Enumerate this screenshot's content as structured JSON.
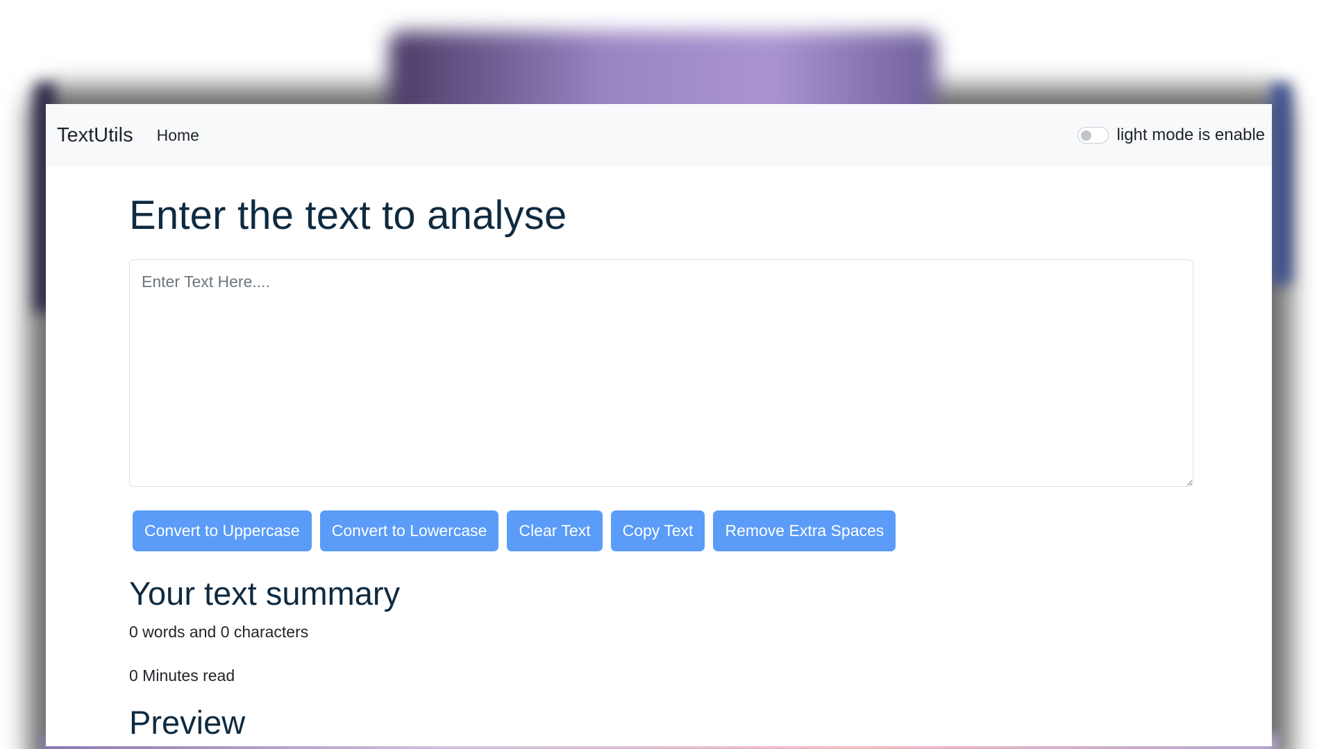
{
  "navbar": {
    "brand": "TextUtils",
    "links": [
      {
        "label": "Home"
      }
    ],
    "mode_toggle": {
      "label": "light mode is enable",
      "checked": false
    }
  },
  "main": {
    "title": "Enter the text to analyse",
    "textarea": {
      "value": "",
      "placeholder": "Enter Text Here...."
    },
    "buttons": [
      {
        "label": "Convert to Uppercase"
      },
      {
        "label": "Convert to Lowercase"
      },
      {
        "label": "Clear Text"
      },
      {
        "label": "Copy Text"
      },
      {
        "label": "Remove Extra Spaces"
      }
    ],
    "summary": {
      "title": "Your text summary",
      "counts": "0 words and 0 characters",
      "read_time": "0 Minutes read"
    },
    "preview": {
      "title": "Preview"
    }
  },
  "colors": {
    "button_bg": "#5a9cf8",
    "heading": "#0e2a40",
    "navbar_bg": "#f8f9fa"
  }
}
